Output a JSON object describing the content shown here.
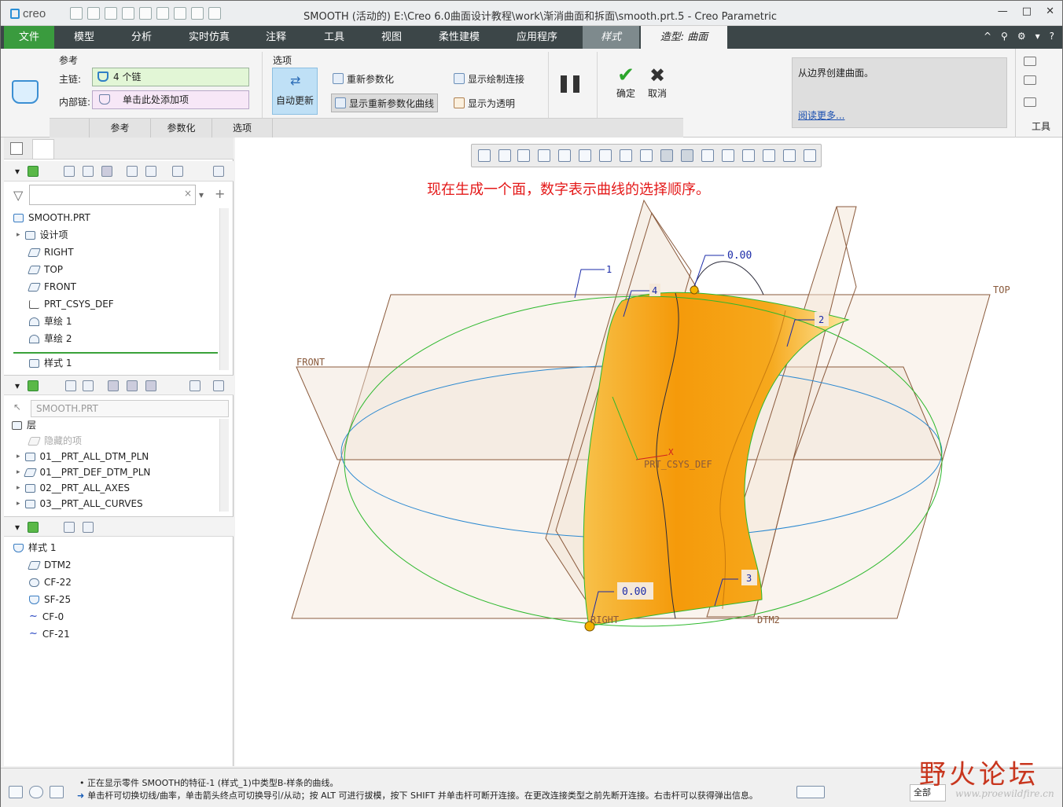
{
  "app": {
    "logo": "creo",
    "window_title": "SMOOTH (活动的) E:\\Creo 6.0曲面设计教程\\work\\渐消曲面和拆面\\smooth.prt.5 - Creo Parametric"
  },
  "ribbon_tabs": [
    "文件",
    "模型",
    "分析",
    "实时仿真",
    "注释",
    "工具",
    "视图",
    "柔性建模",
    "应用程序",
    "样式",
    "造型: 曲面"
  ],
  "ribbon": {
    "ref_group_label": "参考",
    "main_chain_label": "主链:",
    "main_chain_value": "4 个链",
    "inner_chain_label": "内部链:",
    "inner_chain_placeholder": "单击此处添加项",
    "options_label": "选项",
    "auto_update": "自动更新",
    "reparam": "重新参数化",
    "show_reparam_curves": "显示重新参数化曲线",
    "show_draw_connect": "显示绘制连接",
    "show_transparent": "显示为透明",
    "ok": "确定",
    "cancel": "取消",
    "subtabs": [
      "参考",
      "参数化",
      "选项"
    ],
    "help_text": "从边界创建曲面。",
    "help_link": "阅读更多...",
    "tools_label": "工具"
  },
  "model_tree": {
    "root": "SMOOTH.PRT",
    "items": [
      "设计项",
      "RIGHT",
      "TOP",
      "FRONT",
      "PRT_CSYS_DEF",
      "草绘 1",
      "草绘 2",
      "样式 1"
    ]
  },
  "layer_tree": {
    "model_select": "SMOOTH.PRT",
    "root": "层",
    "items": [
      "隐藏的项",
      "01__PRT_ALL_DTM_PLN",
      "01__PRT_DEF_DTM_PLN",
      "02__PRT_ALL_AXES",
      "03__PRT_ALL_CURVES"
    ]
  },
  "style_tree": {
    "root": "样式 1",
    "items": [
      "DTM2",
      "CF-22",
      "SF-25",
      "CF-0",
      "CF-21"
    ]
  },
  "viewport": {
    "annotation": "现在生成一个面，数字表示曲线的选择顺序。",
    "labels": {
      "top": "TOP",
      "front": "FRONT",
      "right": "RIGHT",
      "dtm2": "DTM2",
      "csys": "PRT_CSYS_DEF",
      "x_axis": "X",
      "chain1": "1",
      "chain2": "2",
      "chain3": "3",
      "chain4": "4",
      "value_top": "0.00",
      "value_bottom": "0.00"
    },
    "colors": {
      "surface": "#f5a00e",
      "plane_edge": "#8a5a3c",
      "ellipse_green": "#2db82d",
      "ellipse_blue": "#2a88d0"
    }
  },
  "status": {
    "line1": "正在显示零件 SMOOTH的特征-1 (样式_1)中类型B-样条的曲线。",
    "line2": "单击杆可切换切线/曲率，单击箭头终点可切换导引/从动；按 ALT 可进行拔模，按下 SHIFT 并单击杆可断开连接。在更改连接类型之前先断开连接。右击杆可以获得弹出信息。",
    "filter": "全部"
  },
  "watermark": {
    "text": "野火论坛",
    "url": "www.proewildfire.cn"
  }
}
